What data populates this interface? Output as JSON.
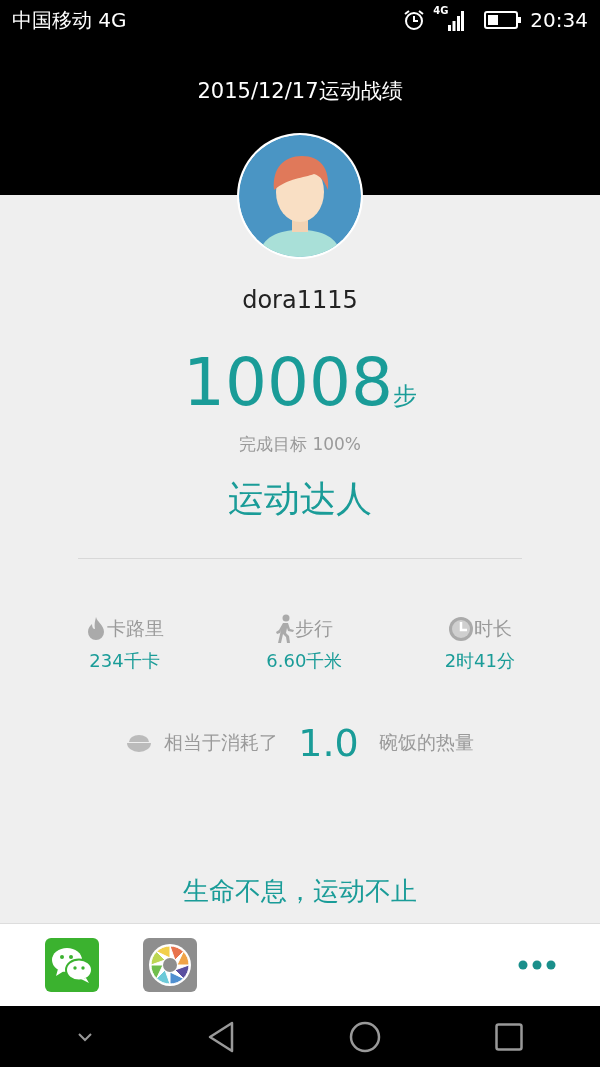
{
  "status_bar": {
    "carrier": "中国移动 4G",
    "network": "4G",
    "time": "20:34"
  },
  "header": {
    "title": "2015/12/17运动战绩"
  },
  "profile": {
    "username": "dora1115"
  },
  "steps": {
    "value": "10008",
    "unit": "步",
    "goal": "完成目标 100%",
    "rank": "运动达人"
  },
  "stats": [
    {
      "kind": "calories",
      "label": "卡路里",
      "value": "234千卡"
    },
    {
      "kind": "walking",
      "label": "步行",
      "value": "6.60千米"
    },
    {
      "kind": "duration",
      "label": "时长",
      "value": "2时41分"
    }
  ],
  "equivalent": {
    "prefix": "相当于消耗了",
    "value": "1.0",
    "suffix": "碗饭的热量"
  },
  "tagline": "生命不息，运动不止",
  "share_apps": [
    {
      "kind": "chat"
    },
    {
      "kind": "camera"
    },
    {
      "kind": "more"
    }
  ]
}
